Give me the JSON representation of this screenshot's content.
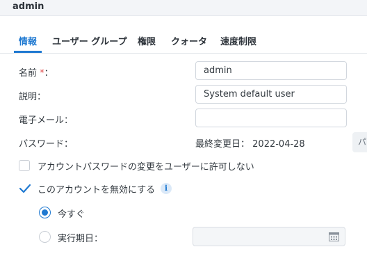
{
  "window": {
    "title": "admin"
  },
  "tabs": [
    {
      "label": "情報",
      "active": true
    },
    {
      "label": "ユーザー グループ",
      "active": false
    },
    {
      "label": "権限",
      "active": false
    },
    {
      "label": "クォータ",
      "active": false
    },
    {
      "label": "速度制限",
      "active": false
    }
  ],
  "form": {
    "name": {
      "label": "名前",
      "required_mark": "*",
      "colon": "：",
      "value": "admin"
    },
    "description": {
      "label": "説明：",
      "value": "System default user"
    },
    "email": {
      "label": "電子メール：",
      "value": ""
    },
    "password": {
      "label": "パスワード：",
      "last_changed_label": "最終変更日：",
      "last_changed_value": "2022-04-28",
      "button_label": "パ"
    },
    "disallow_pw_change": {
      "label": "アカウントパスワードの変更をユーザーに許可しない",
      "checked": false
    },
    "disable_account": {
      "label": "このアカウントを無効にする",
      "checked": true,
      "info_icon": "i"
    },
    "disable_now": {
      "label": "今すぐ",
      "selected": true
    },
    "disable_on_date": {
      "label": "実行期日：",
      "selected": false,
      "value": ""
    }
  },
  "colors": {
    "accent": "#1f79d1",
    "required": "#e04848",
    "text": "#333a40"
  }
}
